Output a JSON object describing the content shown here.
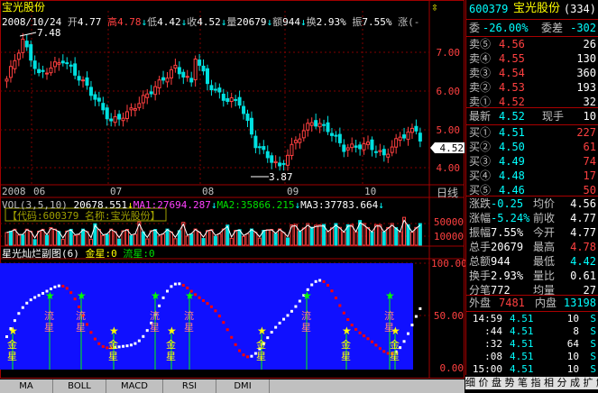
{
  "stock": {
    "name": "宝光股份",
    "code": "600379",
    "tab_count": "(334)"
  },
  "header": {
    "date": "2008/10/24",
    "open_label": "开",
    "open": "4.77",
    "high_label": "高",
    "high": "4.78",
    "low_label": "低",
    "low": "4.42",
    "close_label": "收",
    "close": "4.52",
    "vol_label": "量",
    "vol": "20679",
    "amt_label": "额",
    "amt": "944",
    "turn_label": "换",
    "turn": "2.93%",
    "amp_label": "振",
    "amp": "7.55%",
    "chg_label": "涨(-"
  },
  "price_axis": [
    "7.00",
    "6.00",
    "5.00",
    "4.00"
  ],
  "price_tag": "4.52",
  "annotations": {
    "max": "7.48",
    "min": "3.87"
  },
  "month_labels": [
    "2008",
    "06",
    "07",
    "08",
    "09",
    "10"
  ],
  "period_label": "日线",
  "vol": {
    "label": "VOL(3,5,10)",
    "v": "20678.551",
    "ma1": "MA1:27694.287",
    "ma2": "MA2:35866.215",
    "ma3": "MA3:37783.664",
    "info": "【代码:600379 名称:宝光股份】",
    "axis": [
      "50000",
      "10000"
    ]
  },
  "sub": {
    "title": "星光灿烂副图(6)",
    "gold": "金星:0",
    "flow": "流星:0",
    "axis": [
      "100.00",
      "50.00",
      "0.00"
    ],
    "gold_char1": "金",
    "gold_char2": "星",
    "flow_char1": "流",
    "flow_char2": "星"
  },
  "tabs": [
    "MA",
    "BOLL",
    "MACD",
    "RSI",
    "DMI"
  ],
  "panel": {
    "weibi_label": "委",
    "weibi": "-26.00%",
    "weicha_label": "委差",
    "weicha": "-302",
    "sells": [
      {
        "label": "卖⑤",
        "price": "4.56",
        "vol": "26"
      },
      {
        "label": "卖④",
        "price": "4.55",
        "vol": "130"
      },
      {
        "label": "卖③",
        "price": "4.54",
        "vol": "360"
      },
      {
        "label": "卖②",
        "price": "4.53",
        "vol": "193"
      },
      {
        "label": "卖①",
        "price": "4.52",
        "vol": "32"
      }
    ],
    "latest_label": "最新",
    "latest": "4.52",
    "cur_label": "现手",
    "cur": "10",
    "buys": [
      {
        "label": "买①",
        "price": "4.51",
        "vol": "227"
      },
      {
        "label": "买②",
        "price": "4.50",
        "vol": "61"
      },
      {
        "label": "买③",
        "price": "4.49",
        "vol": "74"
      },
      {
        "label": "买④",
        "price": "4.48",
        "vol": "17"
      },
      {
        "label": "买⑤",
        "price": "4.46",
        "vol": "50"
      }
    ],
    "stats": [
      {
        "l1": "涨跌",
        "v1": "-0.25",
        "l2": "均价",
        "v2": "4.56"
      },
      {
        "l1": "涨幅",
        "v1": "-5.24%",
        "l2": "前收",
        "v2": "4.77"
      },
      {
        "l1": "振幅",
        "v1": "7.55%",
        "l2": "今开",
        "v2": "4.77"
      },
      {
        "l1": "总手",
        "v1": "20679",
        "l2": "最高",
        "v2": "4.78"
      },
      {
        "l1": "总额",
        "v1": "944",
        "l2": "最低",
        "v2": "4.42"
      },
      {
        "l1": "换手",
        "v1": "2.93%",
        "l2": "量比",
        "v2": "0.61"
      },
      {
        "l1": "分笔",
        "v1": "772",
        "l2": "均量",
        "v2": "27"
      }
    ],
    "outer_label": "外盘",
    "outer": "7481",
    "inner_label": "内盘",
    "inner": "13198",
    "ticks": [
      {
        "time": "14:59",
        "price": "4.51",
        "vol": "10",
        "side": "S"
      },
      {
        "time": ":44",
        "price": "4.51",
        "vol": "8",
        "side": "S"
      },
      {
        "time": ":32",
        "price": "4.51",
        "vol": "64",
        "side": "S"
      },
      {
        "time": ":08",
        "price": "4.51",
        "vol": "10",
        "side": "S"
      },
      {
        "time": "15:00",
        "price": "4.51",
        "vol": "10",
        "side": "S"
      }
    ],
    "status": "细 价 盘 势 笔 指 相 分 成 扩 解"
  },
  "colors": {
    "up": "#ff4040",
    "down": "#00e0e0",
    "bg": "#000000",
    "grid": "#a00000"
  }
}
